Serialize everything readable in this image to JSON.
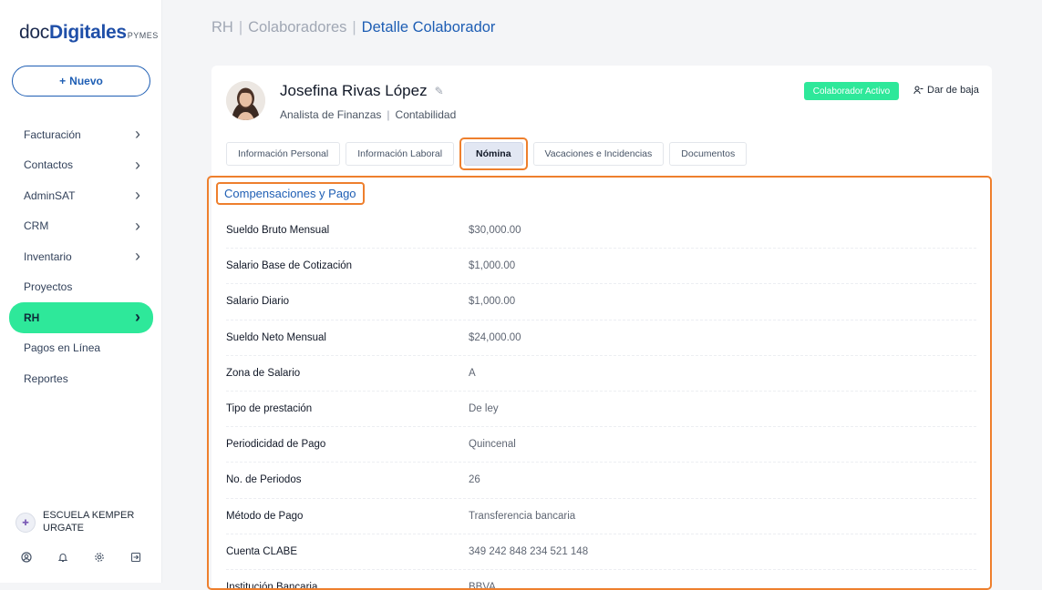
{
  "brand": {
    "part1": "doc",
    "part2": "Digitales",
    "suffix": "PYMES"
  },
  "sidebar": {
    "new_button": {
      "icon": "plus-icon",
      "label": "Nuevo"
    },
    "items": [
      {
        "label": "Facturación",
        "has_chevron": true
      },
      {
        "label": "Contactos",
        "has_chevron": true
      },
      {
        "label": "AdminSAT",
        "has_chevron": true
      },
      {
        "label": "CRM",
        "has_chevron": true
      },
      {
        "label": "Inventario",
        "has_chevron": true
      },
      {
        "label": "Proyectos",
        "has_chevron": false
      },
      {
        "label": "RH",
        "has_chevron": true,
        "active": true
      },
      {
        "label": "Pagos en Línea",
        "has_chevron": false
      },
      {
        "label": "Reportes",
        "has_chevron": false
      }
    ],
    "organization": "ESCUELA KEMPER URGATE",
    "footer_icons": [
      "user-circle-icon",
      "bell-icon",
      "gear-icon",
      "logout-icon"
    ]
  },
  "breadcrumb": {
    "items": [
      "RH",
      "Colaboradores"
    ],
    "current": "Detalle Colaborador"
  },
  "employee": {
    "name": "Josefina Rivas López",
    "position": "Analista de Finanzas",
    "department": "Contabilidad",
    "status": "Colaborador Activo",
    "dismiss_label": "Dar de baja"
  },
  "tabs": [
    {
      "label": "Información Personal"
    },
    {
      "label": "Información Laboral"
    },
    {
      "label": "Nómina",
      "active": true
    },
    {
      "label": "Vacaciones e Incidencias"
    },
    {
      "label": "Documentos"
    }
  ],
  "compensation": {
    "title": "Compensaciones y Pago",
    "fields": [
      {
        "label": "Sueldo Bruto Mensual",
        "value": "$30,000.00"
      },
      {
        "label": "Salario Base de Cotización",
        "value": "$1,000.00"
      },
      {
        "label": "Salario Diario",
        "value": "$1,000.00"
      },
      {
        "label": "Sueldo Neto Mensual",
        "value": "$24,000.00"
      },
      {
        "label": "Zona de Salario",
        "value": "A"
      },
      {
        "label": "Tipo de prestación",
        "value": "De ley"
      },
      {
        "label": "Periodicidad de Pago",
        "value": "Quincenal"
      },
      {
        "label": "No. de Periodos",
        "value": "26"
      },
      {
        "label": "Método de Pago",
        "value": "Transferencia bancaria"
      },
      {
        "label": "Cuenta CLABE",
        "value": "349 242 848 234 521 148"
      },
      {
        "label": "Institución Bancaria",
        "value": "BBVA"
      }
    ]
  },
  "colors": {
    "accent": "#1e5eb4",
    "active_green": "#2ee89a",
    "highlight": "#ee7f2d"
  }
}
